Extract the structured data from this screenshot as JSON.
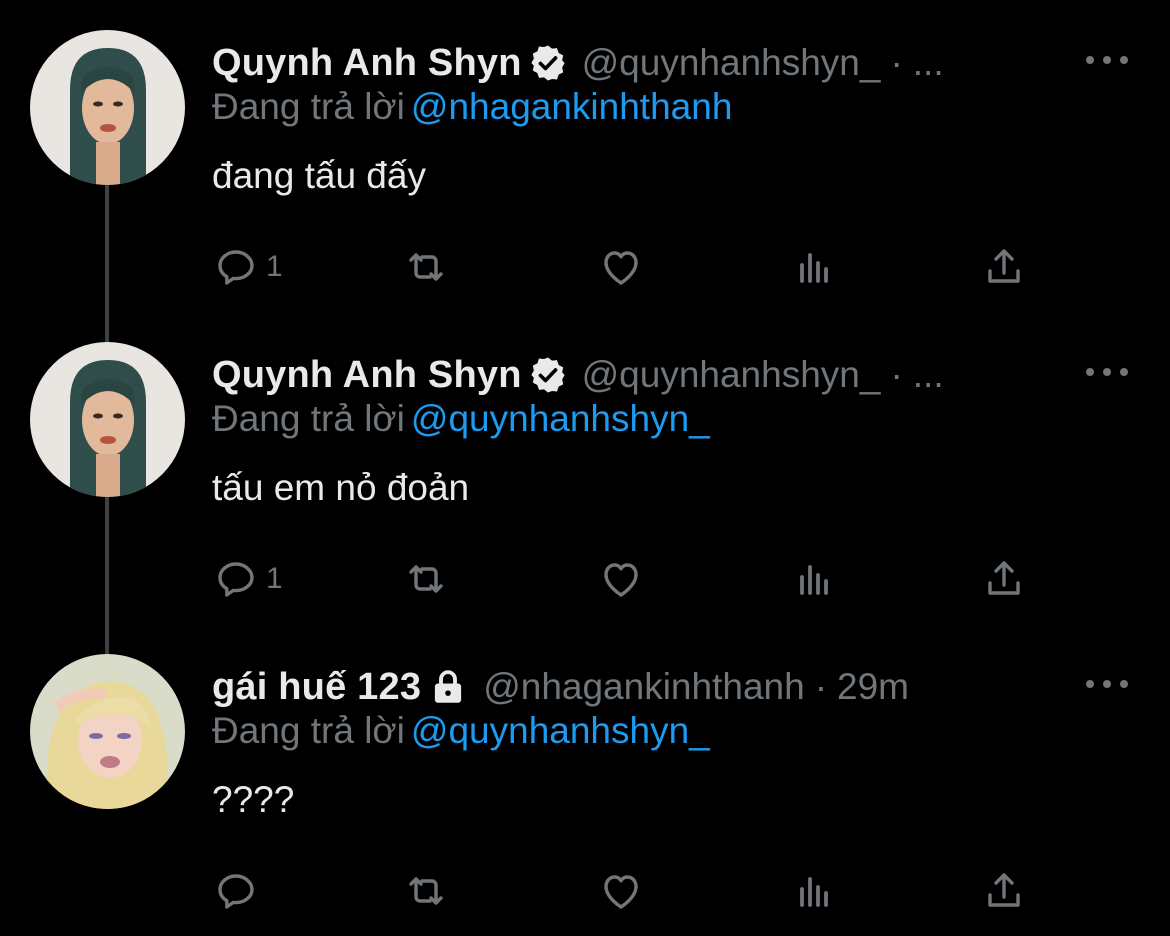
{
  "colors": {
    "background": "#000000",
    "text": "#e7e9ea",
    "muted": "#71767b",
    "mention": "#1d9bf0",
    "thread_line": "#3e4144"
  },
  "tweets": [
    {
      "display_name": "Quynh Anh Shyn",
      "badge_icon": "verified-badge-icon",
      "handle": "@quynhanhshyn_",
      "separator": "·",
      "time": "...",
      "reply_prefix": "Đang trả lời",
      "reply_to": "@nhagankinhthanh",
      "text": "đang tấu đấy",
      "reply_count": "1"
    },
    {
      "display_name": "Quynh Anh Shyn",
      "badge_icon": "verified-badge-icon",
      "handle": "@quynhanhshyn_",
      "separator": "·",
      "time": "...",
      "reply_prefix": "Đang trả lời",
      "reply_to": "@quynhanhshyn_",
      "text": "tấu em nỏ đoản",
      "reply_count": "1"
    },
    {
      "display_name": "gái huế 123",
      "badge_icon": "lock-icon",
      "handle": "@nhagankinhthanh",
      "separator": "·",
      "time": "29m",
      "reply_prefix": "Đang trả lời",
      "reply_to": "@quynhanhshyn_",
      "text": "????",
      "reply_count": ""
    }
  ],
  "action_icons": [
    "reply-icon",
    "retweet-icon",
    "like-icon",
    "views-icon",
    "share-icon"
  ],
  "more_icon": "more-options-icon"
}
